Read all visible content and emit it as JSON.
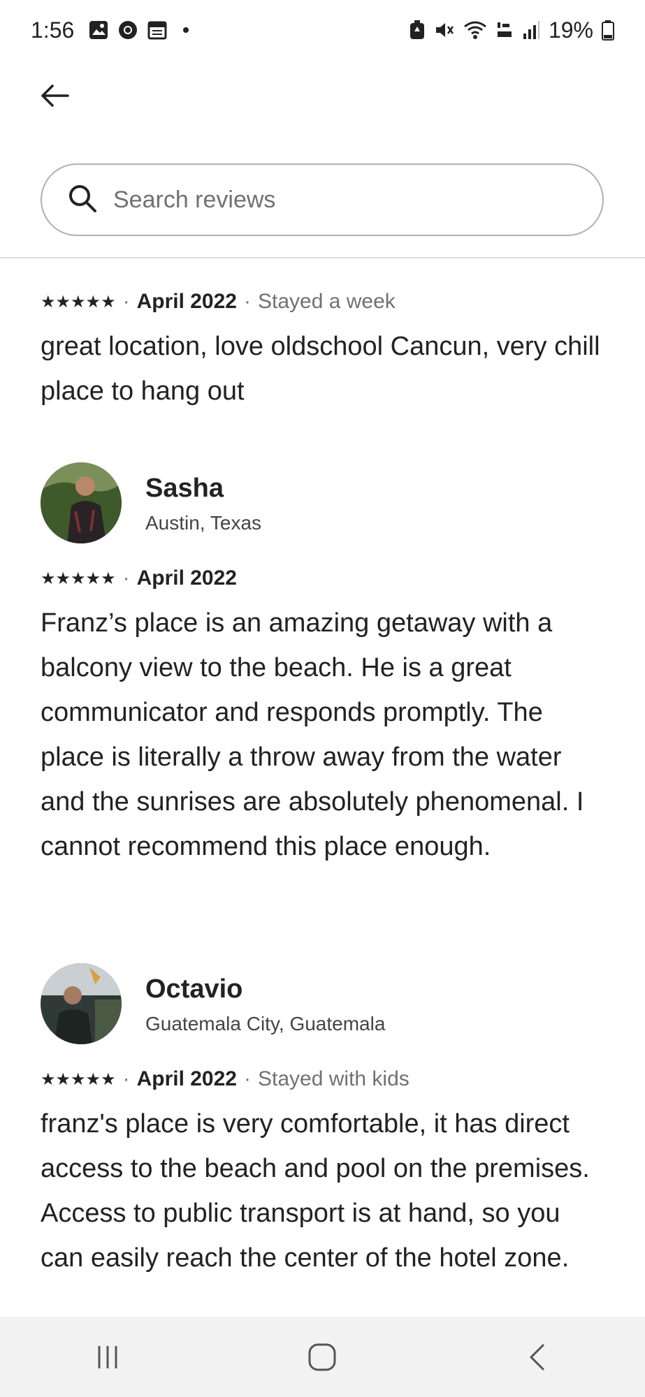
{
  "status_bar": {
    "time": "1:56",
    "battery": "19%",
    "icons_left": [
      "gallery-icon",
      "chrome-icon",
      "calendar-icon",
      "notification-dot"
    ],
    "icons_right": [
      "battery-saver-icon",
      "mute-icon",
      "wifi-icon",
      "volte-icon",
      "signal-icon",
      "battery-icon"
    ]
  },
  "header": {
    "back_icon": "arrow-left-icon",
    "search": {
      "placeholder": "Search reviews",
      "value": ""
    }
  },
  "reviews": [
    {
      "reviewer_name": "",
      "stars": "★★★★★",
      "sep1": "·",
      "date": "April 2022",
      "sep2": "·",
      "stay": "Stayed a week",
      "text": "great location, love oldschool Cancun, very chill place to hang out"
    },
    {
      "reviewer_name": "Sasha",
      "location": "Austin, Texas",
      "stars": "★★★★★",
      "sep1": "·",
      "date": "April 2022",
      "text": "Franz’s place is an amazing getaway with a balcony view to the beach. He is a great communicator and responds promptly. The place is literally a throw away from the water and the sunrises are absolutely phenomenal. I cannot recommend this place enough."
    },
    {
      "reviewer_name": "Octavio",
      "location": "Guatemala City, Guatemala",
      "stars": "★★★★★",
      "sep1": "·",
      "date": "April 2022",
      "sep2": "·",
      "stay": "Stayed with kids",
      "text": "franz's place is very comfortable, it has direct access to the beach and pool on the premises. Access to public transport is at hand, so you can easily reach the center of the hotel zone."
    }
  ],
  "nav_bar": {
    "icons": [
      "recent-apps-icon",
      "home-icon",
      "back-icon"
    ]
  }
}
